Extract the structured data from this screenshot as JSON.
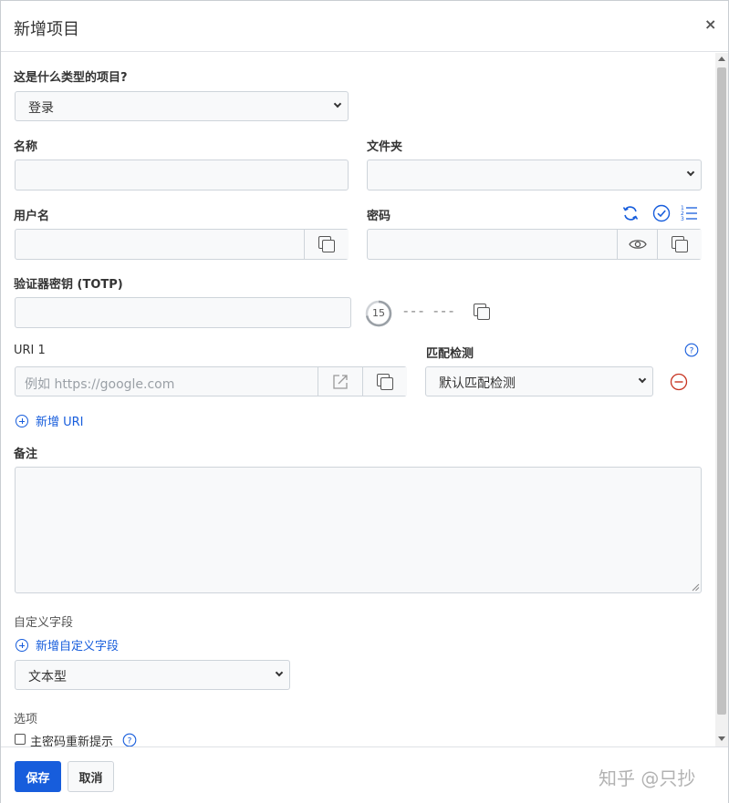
{
  "dialog": {
    "title": "新增项目",
    "close_glyph": "×"
  },
  "type_field": {
    "label": "这是什么类型的项目?",
    "value": "登录"
  },
  "name_field": {
    "label": "名称",
    "value": ""
  },
  "folder_field": {
    "label": "文件夹",
    "value": ""
  },
  "username_field": {
    "label": "用户名",
    "value": ""
  },
  "password_field": {
    "label": "密码",
    "value": ""
  },
  "totp_field": {
    "label": "验证器密钥 (TOTP)",
    "value": "",
    "countdown": "15",
    "code_display": "--- ---"
  },
  "uri_field": {
    "label": "URI 1",
    "placeholder": "例如 https://google.com",
    "match_label": "匹配检测",
    "match_value": "默认匹配检测"
  },
  "add_uri": {
    "label": "新增 URI"
  },
  "notes_field": {
    "label": "备注",
    "value": ""
  },
  "custom_fields": {
    "label": "自定义字段",
    "add_label": "新增自定义字段",
    "type_value": "文本型"
  },
  "options": {
    "label": "选项",
    "reprompt_label": "主密码重新提示",
    "reprompt_checked": false
  },
  "footer": {
    "save_label": "保存",
    "cancel_label": "取消",
    "watermark": "知乎 @只抄"
  },
  "colors": {
    "accent": "#175ddc",
    "danger": "#c83522",
    "border": "#ced4da",
    "field_bg": "#f8f9fa"
  },
  "icons": {
    "regenerate": "refresh-icon",
    "check": "check-circle-icon",
    "history": "list-numbered-icon",
    "copy": "copy-icon",
    "eye": "eye-icon",
    "launch": "launch-icon",
    "remove": "minus-circle-icon",
    "help": "question-circle-icon"
  }
}
